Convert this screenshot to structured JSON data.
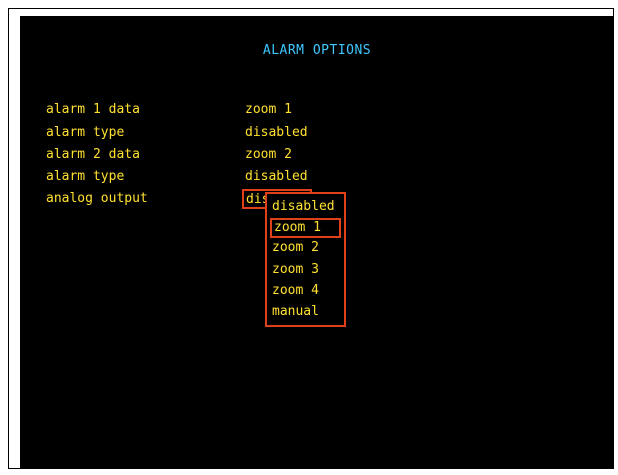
{
  "title": "ALARM OPTIONS",
  "rows": [
    {
      "label": "alarm 1 data",
      "value": "zoom 1"
    },
    {
      "label": "alarm type",
      "value": "disabled"
    },
    {
      "label": "alarm 2 data",
      "value": "zoom 2"
    },
    {
      "label": "alarm type",
      "value": "disabled"
    },
    {
      "label": "analog output",
      "value": "disabled"
    }
  ],
  "dropdown": {
    "options": [
      "disabled",
      "zoom 1",
      "zoom 2",
      "zoom 3",
      "zoom 4",
      "manual"
    ],
    "highlighted": "zoom 1"
  },
  "colors": {
    "background": "#000000",
    "title": "#3ec8ff",
    "text": "#ffe030",
    "highlight_border": "#e0401a"
  }
}
